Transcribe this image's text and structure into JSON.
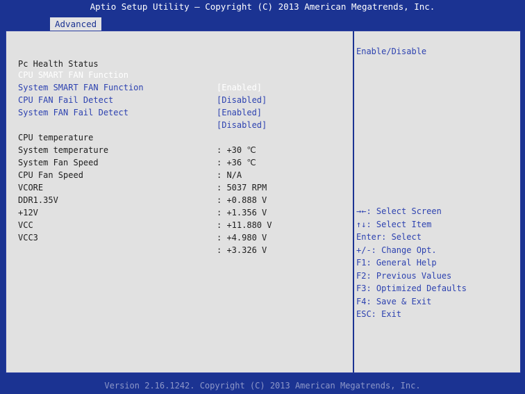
{
  "header": {
    "title": "Aptio Setup Utility – Copyright (C) 2013 American Megatrends, Inc.",
    "active_tab": "Advanced"
  },
  "main": {
    "section_title": "Pc Health Status",
    "options": [
      {
        "label": "CPU SMART FAN Function",
        "value": "[Enabled]",
        "selected": true
      },
      {
        "label": "System SMART FAN Function",
        "value": "[Disabled]",
        "selected": false
      },
      {
        "label": "CPU FAN Fail Detect",
        "value": "[Enabled]",
        "selected": false
      },
      {
        "label": "System FAN Fail Detect",
        "value": "[Disabled]",
        "selected": false
      }
    ],
    "readings": [
      {
        "label": "CPU temperature",
        "value": ": +30 ℃"
      },
      {
        "label": "System temperature",
        "value": ": +36 ℃"
      },
      {
        "label": "System Fan Speed",
        "value": ": N/A"
      },
      {
        "label": "CPU Fan Speed",
        "value": ": 5037 RPM"
      },
      {
        "label": "VCORE",
        "value": ": +0.888 V"
      },
      {
        "label": "DDR1.35V",
        "value": ": +1.356 V"
      },
      {
        "label": "+12V",
        "value": ": +11.880 V"
      },
      {
        "label": "VCC",
        "value": ": +4.980 V"
      },
      {
        "label": "VCC3",
        "value": ": +3.326 V"
      }
    ]
  },
  "help": {
    "description": "Enable/Disable",
    "keys": [
      "→←: Select Screen",
      "↑↓: Select Item",
      "Enter: Select",
      "+/-: Change Opt.",
      "F1: General Help",
      "F2: Previous Values",
      "F3: Optimized Defaults",
      "F4: Save & Exit",
      "ESC: Exit"
    ]
  },
  "footer": {
    "text": "Version 2.16.1242. Copyright (C) 2013 American Megatrends, Inc."
  },
  "colors": {
    "background": "#1b3392",
    "panel": "#e1e1e1",
    "highlight": "#ffffff",
    "option_text": "#2d42b0",
    "info_text": "#202020"
  }
}
